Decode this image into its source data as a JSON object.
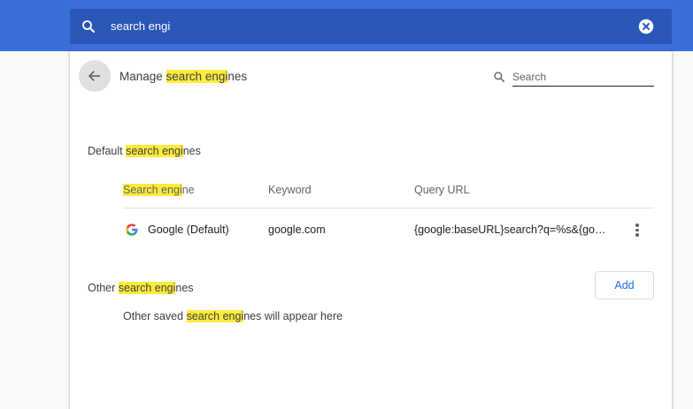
{
  "header": {
    "search_value": "search engi",
    "icons": {
      "search": "search-icon",
      "clear": "close-circle-icon"
    },
    "colors": {
      "topbar": "#3b6fd8",
      "searchbar": "#2a56b8"
    }
  },
  "page": {
    "back_icon": "arrow-left-icon",
    "title_pre": "Manage ",
    "title_hl": "search engi",
    "title_post": "nes",
    "search_placeholder": "Search"
  },
  "default_section": {
    "title_pre": "Default ",
    "title_hl": "search engi",
    "title_post": "nes",
    "columns": {
      "engine_hl": "Search engi",
      "engine_post": "ne",
      "keyword": "Keyword",
      "url": "Query URL"
    },
    "rows": [
      {
        "name": "Google (Default)",
        "keyword": "google.com",
        "url": "{google:baseURL}search?q=%s&{go…",
        "icon": "google-logo-icon"
      }
    ]
  },
  "other_section": {
    "title_pre": "Other ",
    "title_hl": "search engi",
    "title_post": "nes",
    "add_label": "Add",
    "empty_pre": "Other saved ",
    "empty_hl": "search engi",
    "empty_post": "nes will appear here"
  },
  "highlight_color": "#ffeb3b"
}
